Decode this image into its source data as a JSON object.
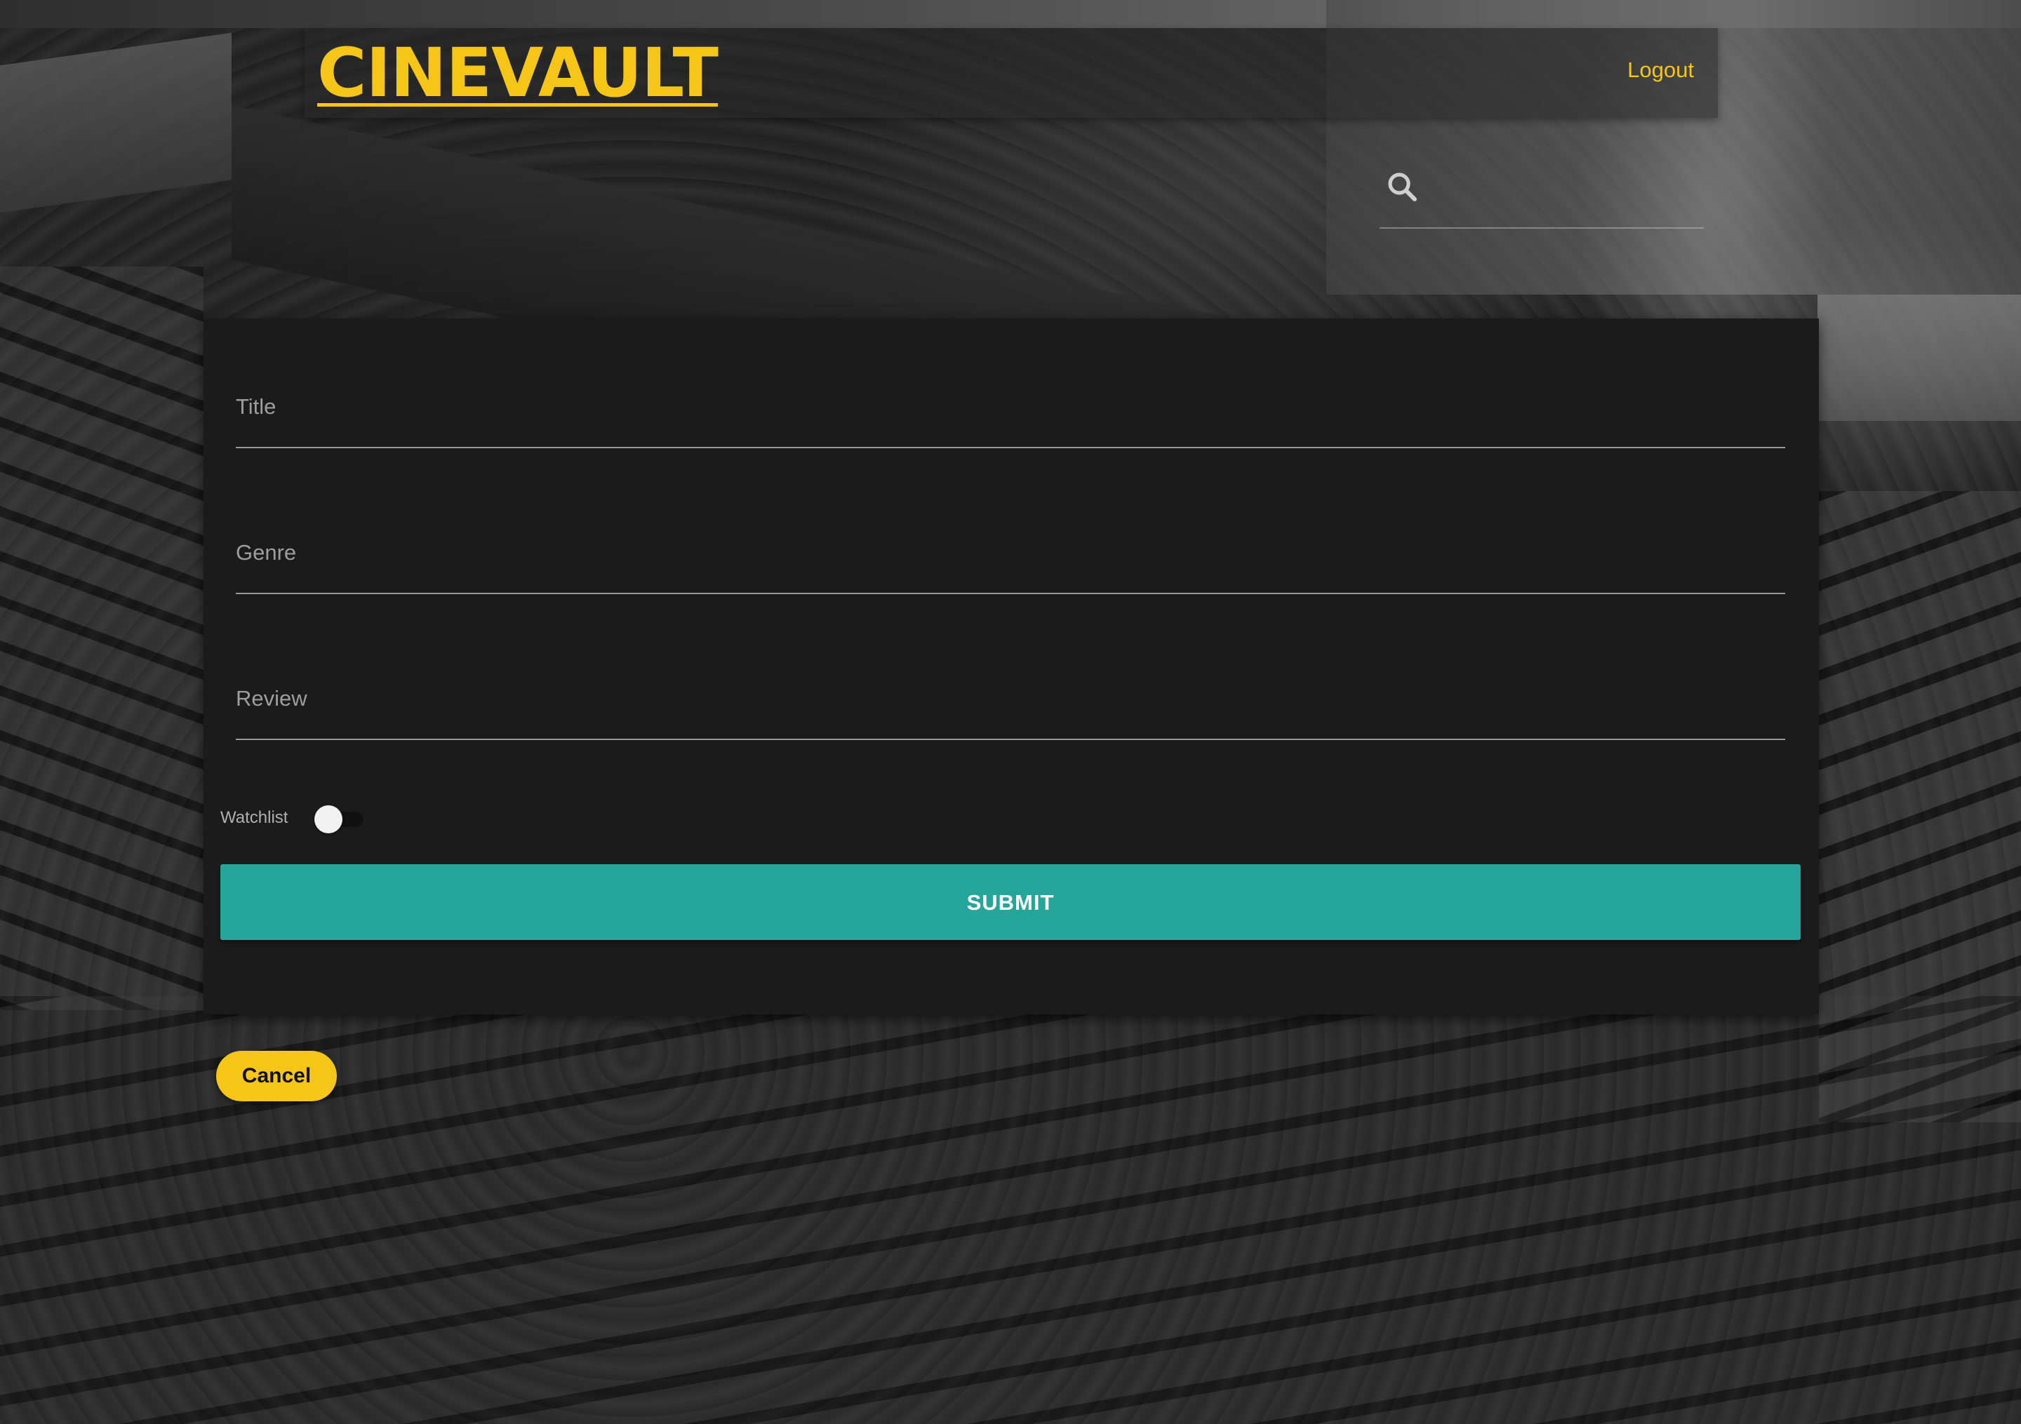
{
  "header": {
    "brand": "CINEVAULT",
    "logout_label": "Logout",
    "search_icon": "search-icon",
    "search_placeholder": ""
  },
  "form": {
    "fields": [
      {
        "label": "Title",
        "value": ""
      },
      {
        "label": "Genre",
        "value": ""
      },
      {
        "label": "Review",
        "value": ""
      }
    ],
    "watchlist": {
      "label": "Watchlist",
      "checked": false
    },
    "submit_label": "SUBMIT"
  },
  "cancel_label": "Cancel",
  "colors": {
    "accent": "#f5c518",
    "submit": "#26a69a",
    "card": "#1b1b1c"
  }
}
